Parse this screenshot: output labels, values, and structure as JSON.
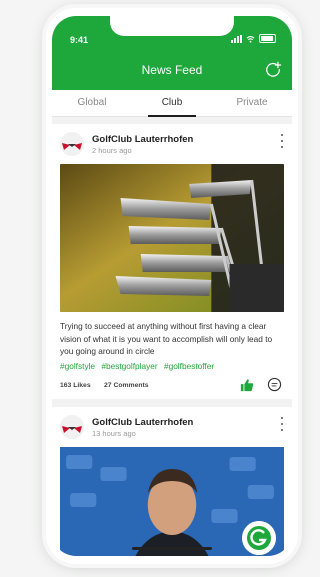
{
  "status_bar": {
    "time": "9:41"
  },
  "header": {
    "title": "News Feed"
  },
  "tabs": [
    {
      "label": "Global",
      "active": false
    },
    {
      "label": "Club",
      "active": true
    },
    {
      "label": "Private",
      "active": false
    }
  ],
  "posts": [
    {
      "author": "GolfClub Lauterrhofen",
      "time": "2 hours ago",
      "text": "Trying to succeed at anything without first having a clear vision of what it is you want to accomplish will only lead to you going around in circle",
      "tags": [
        "#golfstyle",
        "#bestgolfplayer",
        "#golfbestoffer"
      ],
      "likes": "163 Likes",
      "comments": "27 Comments"
    },
    {
      "author": "GolfClub Lauterrhofen",
      "time": "13 hours ago"
    }
  ],
  "colors": {
    "brand": "#1ea83b",
    "tag": "#1ea83b"
  },
  "icons": [
    "add-post-icon",
    "more-options-icon",
    "like-icon",
    "comment-icon",
    "club-logo-icon"
  ]
}
